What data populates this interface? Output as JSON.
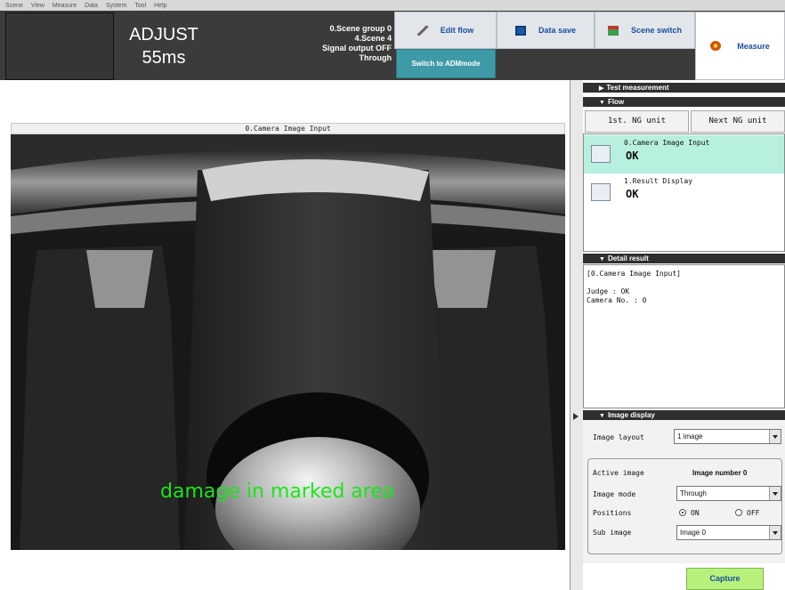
{
  "menubar": {
    "items": [
      "Scene",
      "View",
      "Measure",
      "Data",
      "System",
      "Tool",
      "Help"
    ]
  },
  "header": {
    "mode": "ADJUST",
    "time": "55ms",
    "status": [
      "0.Scene group 0",
      "4.Scene 4",
      "Signal output OFF",
      "Through"
    ],
    "buttons": {
      "edit_flow": {
        "label": "Edit flow",
        "icon": "pencil-icon"
      },
      "data_save": {
        "label": "Data save",
        "icon": "disk-icon"
      },
      "scene_switch": {
        "label": "Scene switch",
        "icon": "switch-icon"
      },
      "measure": {
        "label": "Measure",
        "icon": "measure-icon"
      },
      "switch_adm": {
        "label": "Switch to ADMmode"
      }
    }
  },
  "image": {
    "title": "0.Camera Image Input",
    "overlay_text": "damage in marked area",
    "overlay_color": "#19e619"
  },
  "panel": {
    "test_measurement": "Test measurement",
    "flow_title": "Flow",
    "nav_first": "1st. NG unit",
    "nav_next": "Next NG unit",
    "flow_items": [
      {
        "name": "0.Camera Image Input",
        "result": "OK"
      },
      {
        "name": "1.Result Display",
        "result": "OK"
      }
    ],
    "detail_title": "Detail result",
    "detail_text": "[0.Camera Image Input]\n\nJudge : OK\nCamera No. : 0",
    "image_display_title": "Image display",
    "image_layout_label": "Image layout",
    "image_layout_value": "1 image",
    "active_image_label": "Active image",
    "active_image_value": "Image number 0",
    "image_mode_label": "Image mode",
    "image_mode_value": "Through",
    "positions_label": "Positions",
    "positions_on": "ON",
    "positions_off": "OFF",
    "positions_selected": "ON",
    "sub_image_label": "Sub image",
    "sub_image_value": "Image 0",
    "capture": "Capture"
  },
  "colors": {
    "accent_teal": "#3f9aa8",
    "selected_row": "#b7f0de",
    "capture_green": "#b8f07c",
    "header_bg": "#3b3b3b"
  }
}
